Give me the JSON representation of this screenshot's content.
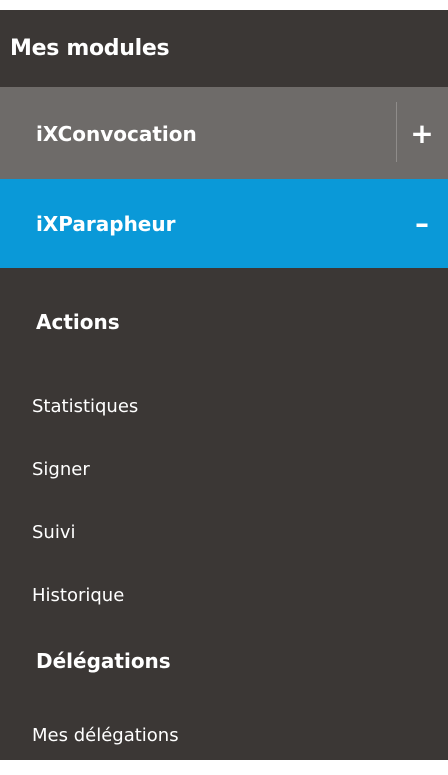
{
  "header": {
    "title": "Mes modules"
  },
  "modules": [
    {
      "label": "iXConvocation",
      "toggle": "+",
      "state": "collapsed",
      "color": "#6e6b69"
    },
    {
      "label": "iXParapheur",
      "toggle": "–",
      "state": "expanded",
      "color": "#0a99d8"
    }
  ],
  "sections": {
    "actions": {
      "title": "Actions",
      "items": [
        "Statistiques",
        "Signer",
        "Suivi",
        "Historique"
      ]
    },
    "delegations": {
      "title": "Délégations",
      "items": [
        "Mes délégations"
      ]
    }
  },
  "colors": {
    "background": "#3b3735",
    "accent": "#0a99d8",
    "collapsed_module": "#6e6b69",
    "text": "#ffffff"
  }
}
